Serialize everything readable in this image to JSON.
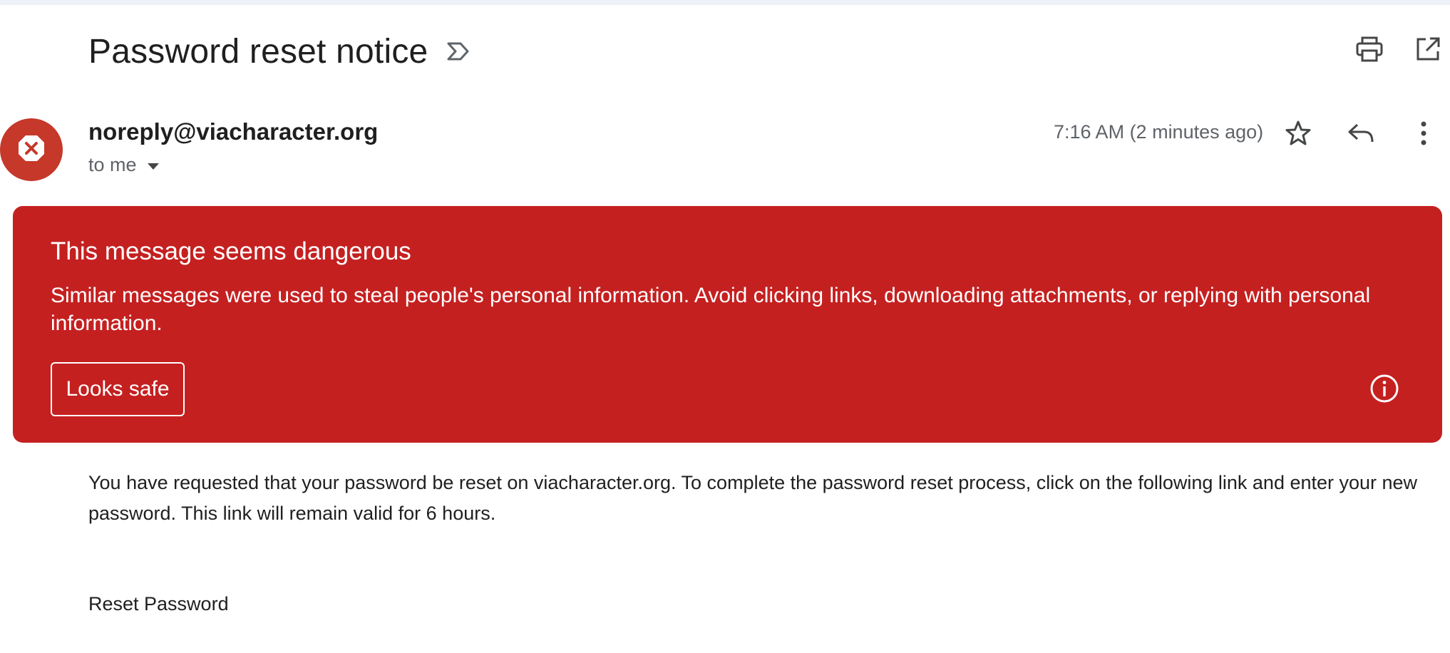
{
  "email": {
    "subject": "Password reset notice",
    "sender": "noreply@viacharacter.org",
    "recipient": "to me",
    "time": "7:16 AM (2 minutes ago)"
  },
  "icons": {
    "label": "label-icon",
    "print": "print-icon",
    "open_new_window": "open-in-new-icon",
    "avatar": "blocked-x-icon",
    "dropdown": "chevron-down-icon",
    "star": "star-icon",
    "reply": "reply-icon",
    "more": "more-vert-icon",
    "info": "info-icon"
  },
  "warning": {
    "title": "This message seems dangerous",
    "text": "Similar messages were used to steal people's personal information. Avoid clicking links, downloading attachments, or replying with personal information.",
    "button": "Looks safe",
    "color": "#c52020"
  },
  "body": {
    "paragraph": "You have requested that your password be reset on viacharacter.org. To complete the password reset process, click on the following link and enter your new password. This link will remain valid for 6 hours.",
    "link_text": "Reset Password"
  },
  "colors": {
    "avatar": "#c5382a",
    "text": "#1f1f1f",
    "secondary": "#5f6368"
  }
}
